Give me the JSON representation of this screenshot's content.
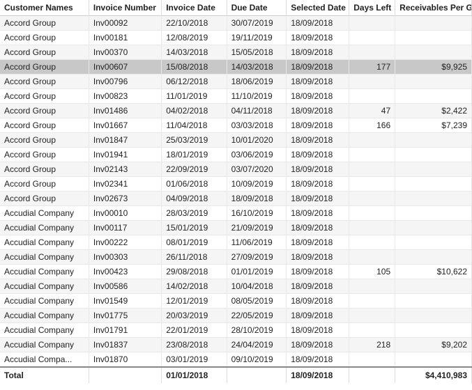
{
  "table": {
    "columns": [
      {
        "key": "customer",
        "label": "Customer Names"
      },
      {
        "key": "invoice_number",
        "label": "Invoice Number"
      },
      {
        "key": "invoice_date",
        "label": "Invoice Date"
      },
      {
        "key": "due_date",
        "label": "Due Date"
      },
      {
        "key": "selected_date",
        "label": "Selected Date"
      },
      {
        "key": "days_left",
        "label": "Days Left"
      },
      {
        "key": "receivables",
        "label": "Receivables Per Group"
      }
    ],
    "rows": [
      {
        "customer": "Accord Group",
        "invoice_number": "Inv00092",
        "invoice_date": "22/10/2018",
        "due_date": "30/07/2019",
        "selected_date": "18/09/2018",
        "days_left": "",
        "receivables": "",
        "highlighted": false
      },
      {
        "customer": "Accord Group",
        "invoice_number": "Inv00181",
        "invoice_date": "12/08/2019",
        "due_date": "19/11/2019",
        "selected_date": "18/09/2018",
        "days_left": "",
        "receivables": "",
        "highlighted": false
      },
      {
        "customer": "Accord Group",
        "invoice_number": "Inv00370",
        "invoice_date": "14/03/2018",
        "due_date": "15/05/2018",
        "selected_date": "18/09/2018",
        "days_left": "",
        "receivables": "",
        "highlighted": false
      },
      {
        "customer": "Accord Group",
        "invoice_number": "Inv00607",
        "invoice_date": "15/08/2018",
        "due_date": "14/03/2018",
        "selected_date": "18/09/2018",
        "days_left": "177",
        "receivables": "$9,925",
        "highlighted": true
      },
      {
        "customer": "Accord Group",
        "invoice_number": "Inv00796",
        "invoice_date": "06/12/2018",
        "due_date": "18/06/2019",
        "selected_date": "18/09/2018",
        "days_left": "",
        "receivables": "",
        "highlighted": false
      },
      {
        "customer": "Accord Group",
        "invoice_number": "Inv00823",
        "invoice_date": "11/01/2019",
        "due_date": "11/10/2019",
        "selected_date": "18/09/2018",
        "days_left": "",
        "receivables": "",
        "highlighted": false
      },
      {
        "customer": "Accord Group",
        "invoice_number": "Inv01486",
        "invoice_date": "04/02/2018",
        "due_date": "04/11/2018",
        "selected_date": "18/09/2018",
        "days_left": "47",
        "receivables": "$2,422",
        "highlighted": false
      },
      {
        "customer": "Accord Group",
        "invoice_number": "Inv01667",
        "invoice_date": "11/04/2018",
        "due_date": "03/03/2018",
        "selected_date": "18/09/2018",
        "days_left": "166",
        "receivables": "$7,239",
        "highlighted": false
      },
      {
        "customer": "Accord Group",
        "invoice_number": "Inv01847",
        "invoice_date": "25/03/2019",
        "due_date": "10/01/2020",
        "selected_date": "18/09/2018",
        "days_left": "",
        "receivables": "",
        "highlighted": false
      },
      {
        "customer": "Accord Group",
        "invoice_number": "Inv01941",
        "invoice_date": "18/01/2019",
        "due_date": "03/06/2019",
        "selected_date": "18/09/2018",
        "days_left": "",
        "receivables": "",
        "highlighted": false
      },
      {
        "customer": "Accord Group",
        "invoice_number": "Inv02143",
        "invoice_date": "22/09/2019",
        "due_date": "03/07/2020",
        "selected_date": "18/09/2018",
        "days_left": "",
        "receivables": "",
        "highlighted": false
      },
      {
        "customer": "Accord Group",
        "invoice_number": "Inv02341",
        "invoice_date": "01/06/2018",
        "due_date": "10/09/2019",
        "selected_date": "18/09/2018",
        "days_left": "",
        "receivables": "",
        "highlighted": false
      },
      {
        "customer": "Accord Group",
        "invoice_number": "Inv02673",
        "invoice_date": "04/09/2018",
        "due_date": "18/09/2018",
        "selected_date": "18/09/2018",
        "days_left": "",
        "receivables": "",
        "highlighted": false
      },
      {
        "customer": "Accudial Company",
        "invoice_number": "Inv00010",
        "invoice_date": "28/03/2019",
        "due_date": "16/10/2019",
        "selected_date": "18/09/2018",
        "days_left": "",
        "receivables": "",
        "highlighted": false
      },
      {
        "customer": "Accudial Company",
        "invoice_number": "Inv00117",
        "invoice_date": "15/01/2019",
        "due_date": "21/09/2019",
        "selected_date": "18/09/2018",
        "days_left": "",
        "receivables": "",
        "highlighted": false
      },
      {
        "customer": "Accudial Company",
        "invoice_number": "Inv00222",
        "invoice_date": "08/01/2019",
        "due_date": "11/06/2019",
        "selected_date": "18/09/2018",
        "days_left": "",
        "receivables": "",
        "highlighted": false
      },
      {
        "customer": "Accudial Company",
        "invoice_number": "Inv00303",
        "invoice_date": "26/11/2018",
        "due_date": "27/09/2019",
        "selected_date": "18/09/2018",
        "days_left": "",
        "receivables": "",
        "highlighted": false
      },
      {
        "customer": "Accudial Company",
        "invoice_number": "Inv00423",
        "invoice_date": "29/08/2018",
        "due_date": "01/01/2019",
        "selected_date": "18/09/2018",
        "days_left": "105",
        "receivables": "$10,622",
        "highlighted": false
      },
      {
        "customer": "Accudial Company",
        "invoice_number": "Inv00586",
        "invoice_date": "14/02/2018",
        "due_date": "10/04/2018",
        "selected_date": "18/09/2018",
        "days_left": "",
        "receivables": "",
        "highlighted": false
      },
      {
        "customer": "Accudial Company",
        "invoice_number": "Inv01549",
        "invoice_date": "12/01/2019",
        "due_date": "08/05/2019",
        "selected_date": "18/09/2018",
        "days_left": "",
        "receivables": "",
        "highlighted": false
      },
      {
        "customer": "Accudial Company",
        "invoice_number": "Inv01775",
        "invoice_date": "20/03/2019",
        "due_date": "22/05/2019",
        "selected_date": "18/09/2018",
        "days_left": "",
        "receivables": "",
        "highlighted": false
      },
      {
        "customer": "Accudial Company",
        "invoice_number": "Inv01791",
        "invoice_date": "22/01/2019",
        "due_date": "28/10/2019",
        "selected_date": "18/09/2018",
        "days_left": "",
        "receivables": "",
        "highlighted": false
      },
      {
        "customer": "Accudial Company",
        "invoice_number": "Inv01837",
        "invoice_date": "23/08/2018",
        "due_date": "24/04/2019",
        "selected_date": "18/09/2018",
        "days_left": "218",
        "receivables": "$9,202",
        "highlighted": false
      },
      {
        "customer": "Accudial Compa...",
        "invoice_number": "Inv01870",
        "invoice_date": "03/01/2019",
        "due_date": "09/10/2019",
        "selected_date": "18/09/2018",
        "days_left": "",
        "receivables": "",
        "highlighted": false
      }
    ],
    "footer": {
      "label": "Total",
      "invoice_date": "01/01/2018",
      "selected_date": "18/09/2018",
      "receivables": "$4,410,983"
    }
  }
}
